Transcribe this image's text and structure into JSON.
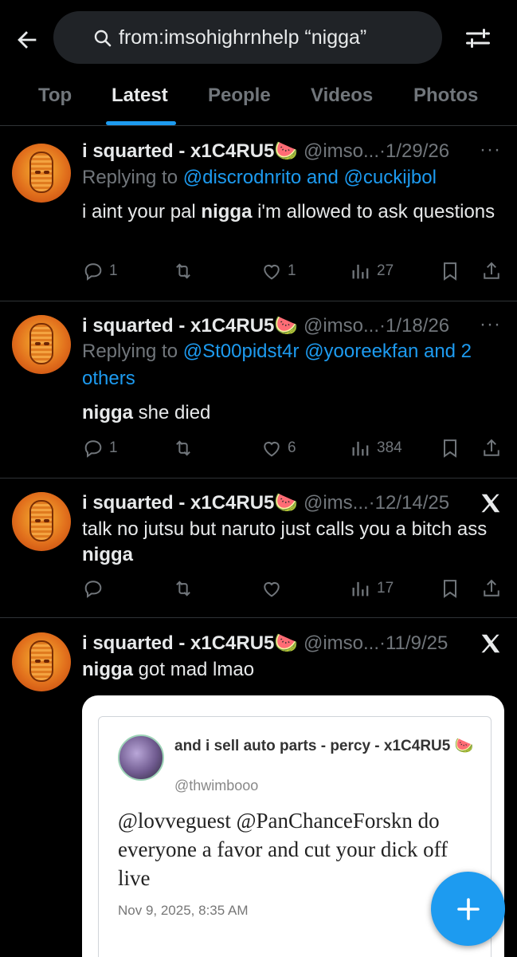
{
  "search": {
    "query": "from:imsohighrnhelp “nigga”"
  },
  "tabs": [
    {
      "label": "Top"
    },
    {
      "label": "Latest"
    },
    {
      "label": "People"
    },
    {
      "label": "Videos"
    },
    {
      "label": "Photos"
    }
  ],
  "tweets": [
    {
      "name": "i squarted - x1C4RU5🍉",
      "handle": "@imso...",
      "date": "·1/29/26",
      "reply_prefix": "Replying to ",
      "reply_mentions": "@discrodnrito and @cuckijbol",
      "text_before": "i aint your pal ",
      "text_bold": "nigga",
      "text_after": " i'm allowed to ask questions",
      "replies": "1",
      "reposts": "",
      "likes": "1",
      "views": "27"
    },
    {
      "name": "i squarted - x1C4RU5🍉",
      "handle": "@imso...",
      "date": "·1/18/26",
      "reply_prefix": "Replying to ",
      "reply_mentions": "@St00pidst4r @yooreekfan and 2 others",
      "text_bold": "nigga",
      "text_after": " she died",
      "replies": "1",
      "reposts": "",
      "likes": "6",
      "views": "384"
    },
    {
      "name": "i squarted - x1C4RU5🍉",
      "handle": "@ims...",
      "date": "·12/14/25",
      "text_before": "talk no jutsu but naruto just calls you a bitch ass ",
      "text_bold": "nigga",
      "views": "17"
    },
    {
      "name": "i squarted - x1C4RU5🍉",
      "handle": "@imso...",
      "date": "·11/9/25",
      "text_bold": "nigga",
      "text_after": " got mad lmao"
    }
  ],
  "quoted": {
    "name": "and i sell auto parts - percy - x1C4RU5 🍉",
    "handle": "@thwimbooo",
    "text": "@lovveguest @PanChanceForskn do everyone a favor and cut your dick off live",
    "date": "Nov 9, 2025, 8:35 AM"
  },
  "colors": {
    "accent": "#1d9bf0",
    "muted": "#71767b",
    "background": "#000000"
  },
  "icons": {
    "back": "back-arrow-icon",
    "search": "search-icon",
    "filter": "filter-sliders-icon",
    "more": "more-dots-icon",
    "x": "x-logo-icon",
    "reply": "reply-icon",
    "repost": "repost-icon",
    "like": "heart-icon",
    "views": "views-chart-icon",
    "bookmark": "bookmark-icon",
    "share": "share-icon",
    "compose": "plus-icon"
  }
}
